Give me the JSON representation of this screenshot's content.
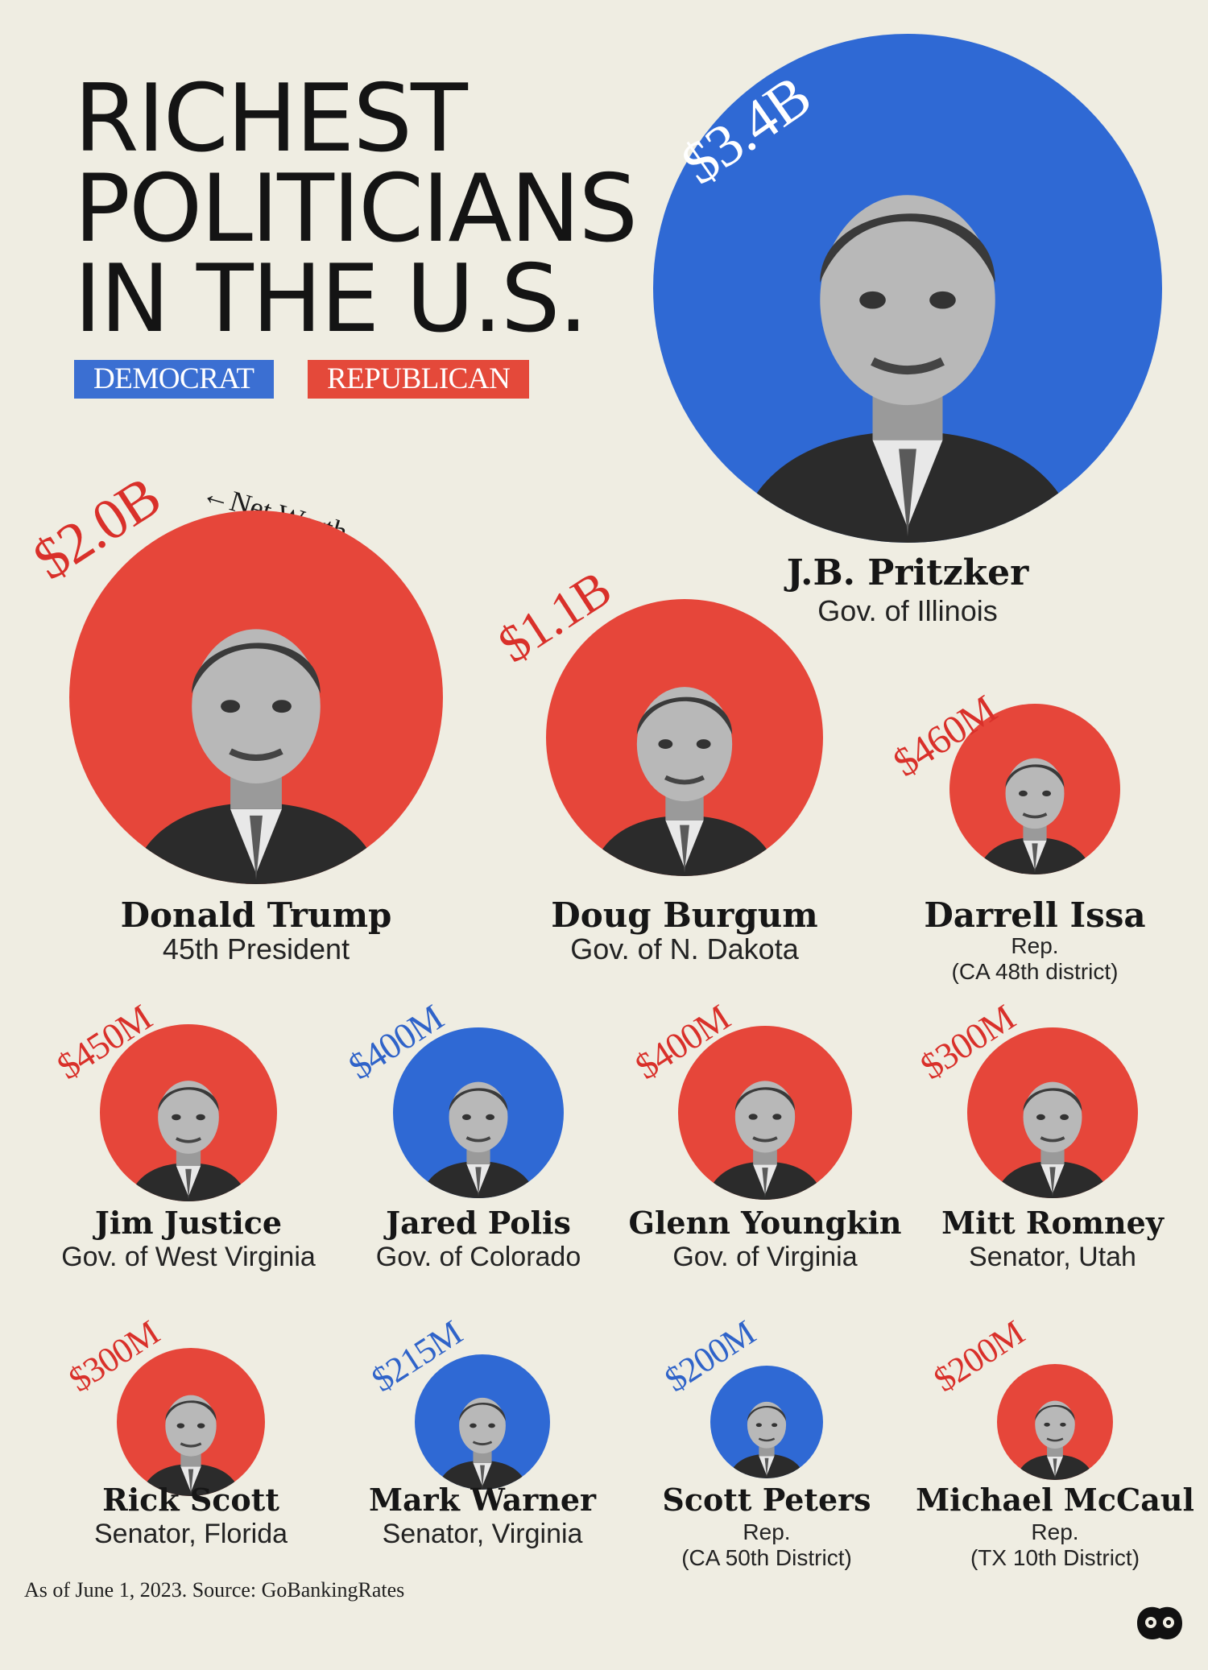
{
  "title": {
    "line1": "RICHEST",
    "line2": "POLITICIANS",
    "line3": "IN THE U.S."
  },
  "legend": {
    "democrat": "DEMOCRAT",
    "republican": "REPUBLICAN"
  },
  "colors": {
    "democrat": "#2f69d4",
    "republican": "#e6463a",
    "background": "#efede2"
  },
  "net_worth_note": "←Net Worth",
  "politicians": [
    {
      "name": "J.B. Pritzker",
      "role": "Gov. of Illinois",
      "net_worth": "$3.4B",
      "party": "Democrat"
    },
    {
      "name": "Donald Trump",
      "role": "45th President",
      "net_worth": "$2.0B",
      "party": "Republican"
    },
    {
      "name": "Doug Burgum",
      "role": "Gov. of N. Dakota",
      "net_worth": "$1.1B",
      "party": "Republican"
    },
    {
      "name": "Darrell Issa",
      "role": "Rep.",
      "role2": "(CA 48th district)",
      "net_worth": "$460M",
      "party": "Republican"
    },
    {
      "name": "Jim Justice",
      "role": "Gov. of West Virginia",
      "net_worth": "$450M",
      "party": "Republican"
    },
    {
      "name": "Jared Polis",
      "role": "Gov. of Colorado",
      "net_worth": "$400M",
      "party": "Democrat"
    },
    {
      "name": "Glenn Youngkin",
      "role": "Gov. of Virginia",
      "net_worth": "$400M",
      "party": "Republican"
    },
    {
      "name": "Mitt Romney",
      "role": "Senator, Utah",
      "net_worth": "$300M",
      "party": "Republican"
    },
    {
      "name": "Rick Scott",
      "role": "Senator, Florida",
      "net_worth": "$300M",
      "party": "Republican"
    },
    {
      "name": "Mark Warner",
      "role": "Senator, Virginia",
      "net_worth": "$215M",
      "party": "Democrat"
    },
    {
      "name": "Scott Peters",
      "role": "Rep.",
      "role2": "(CA 50th District)",
      "net_worth": "$200M",
      "party": "Democrat"
    },
    {
      "name": "Michael McCaul",
      "role": "Rep.",
      "role2": "(TX 10th District)",
      "net_worth": "$200M",
      "party": "Republican"
    }
  ],
  "source": "As of June 1, 2023. Source: GoBankingRates",
  "logo_icon": "visual-capitalist-logo-icon"
}
